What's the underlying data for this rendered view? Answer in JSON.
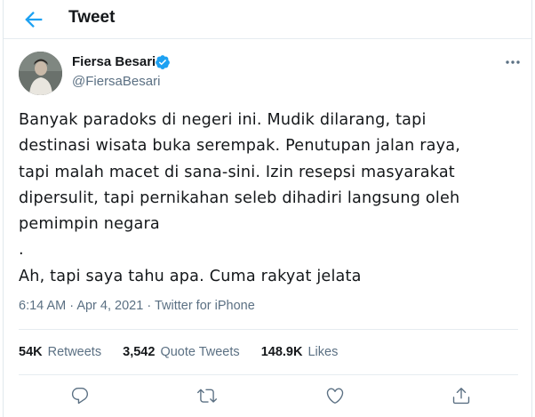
{
  "header": {
    "title": "Tweet",
    "back_icon": "arrow-left-icon"
  },
  "colors": {
    "accent": "#1da1f2",
    "text": "#14171a",
    "muted": "#5b7083",
    "border": "#e6ecf0"
  },
  "author": {
    "name": "Fiersa Besari",
    "handle": "@FiersaBesari",
    "verified": true
  },
  "tweet": {
    "lines": [
      "Banyak paradoks di negeri ini. Mudik dilarang, tapi",
      "destinasi wisata buka serempak. Penutupan jalan raya,",
      "tapi malah macet di sana-sini. Izin resepsi masyarakat",
      "dipersulit, tapi pernikahan seleb dihadiri langsung oleh",
      "pemimpin negara",
      ".",
      "Ah, tapi saya tahu apa. Cuma rakyat jelata"
    ]
  },
  "meta": {
    "time": "6:14 AM",
    "dot": "·",
    "date": "Apr 4, 2021",
    "source": "Twitter for iPhone"
  },
  "stats": {
    "retweets": {
      "count": "54K",
      "label": "Retweets"
    },
    "quotes": {
      "count": "3,542",
      "label": "Quote Tweets"
    },
    "likes": {
      "count": "148.9K",
      "label": "Likes"
    }
  },
  "actions": [
    "reply-icon",
    "retweet-icon",
    "like-icon",
    "share-icon"
  ]
}
